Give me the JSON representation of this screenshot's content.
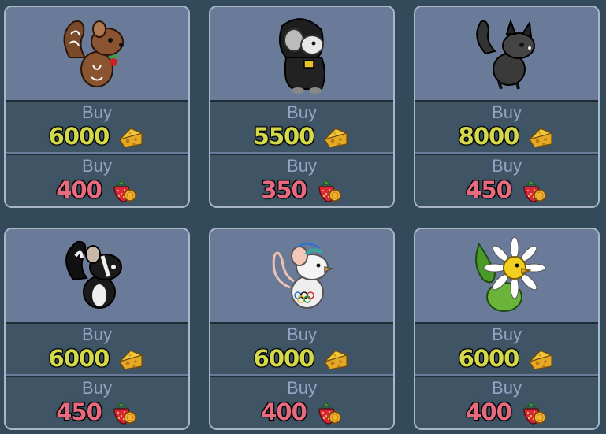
{
  "buy_label": "Buy",
  "icons": {
    "cheese": "cheese-icon",
    "strawberry": "strawberry-icon"
  },
  "colors": {
    "background": "#324a59",
    "card": "#6a7a99",
    "row": "#3f5566",
    "cheese_price": "#d4d94a",
    "berry_price": "#e86a7e"
  },
  "items": [
    {
      "name": "gingerbread-mouse",
      "cheese_price": "6000",
      "berry_price": "400"
    },
    {
      "name": "hooded-mouse",
      "cheese_price": "5500",
      "berry_price": "350"
    },
    {
      "name": "dark-wolf-mouse",
      "cheese_price": "8000",
      "berry_price": "450"
    },
    {
      "name": "skunk-mouse",
      "cheese_price": "6000",
      "berry_price": "450"
    },
    {
      "name": "olympic-mouse",
      "cheese_price": "6000",
      "berry_price": "400"
    },
    {
      "name": "daisy-mouse",
      "cheese_price": "6000",
      "berry_price": "400"
    }
  ]
}
